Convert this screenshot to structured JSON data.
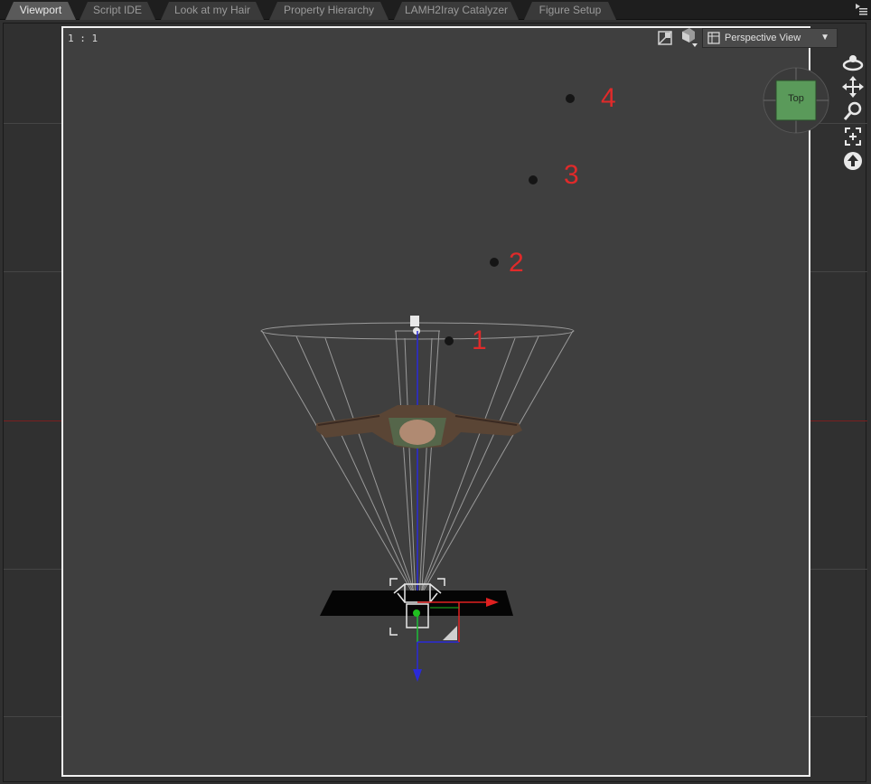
{
  "tabs": [
    {
      "label": "Viewport",
      "active": true
    },
    {
      "label": "Script IDE",
      "active": false
    },
    {
      "label": "Look at my Hair",
      "active": false
    },
    {
      "label": "Property Hierarchy",
      "active": false
    },
    {
      "label": "LAMH2Iray Catalyzer",
      "active": false
    },
    {
      "label": "Figure Setup",
      "active": false
    }
  ],
  "viewport": {
    "ratio": "1 : 1",
    "view_dropdown": {
      "selected": "Perspective View"
    },
    "navcube_face": "Top",
    "markers": [
      "1",
      "2",
      "3",
      "4"
    ]
  },
  "side_tools": [
    "orbit-icon",
    "pan-icon",
    "zoom-icon",
    "frame-icon",
    "reset-view-icon"
  ],
  "colors": {
    "viewport_bg": "#3f3f3f",
    "marker_label": "#e02a2a",
    "navcube_face": "#5a9a5a",
    "axis_x": "#e02020",
    "axis_y": "#20c020",
    "axis_z": "#2020e0"
  }
}
